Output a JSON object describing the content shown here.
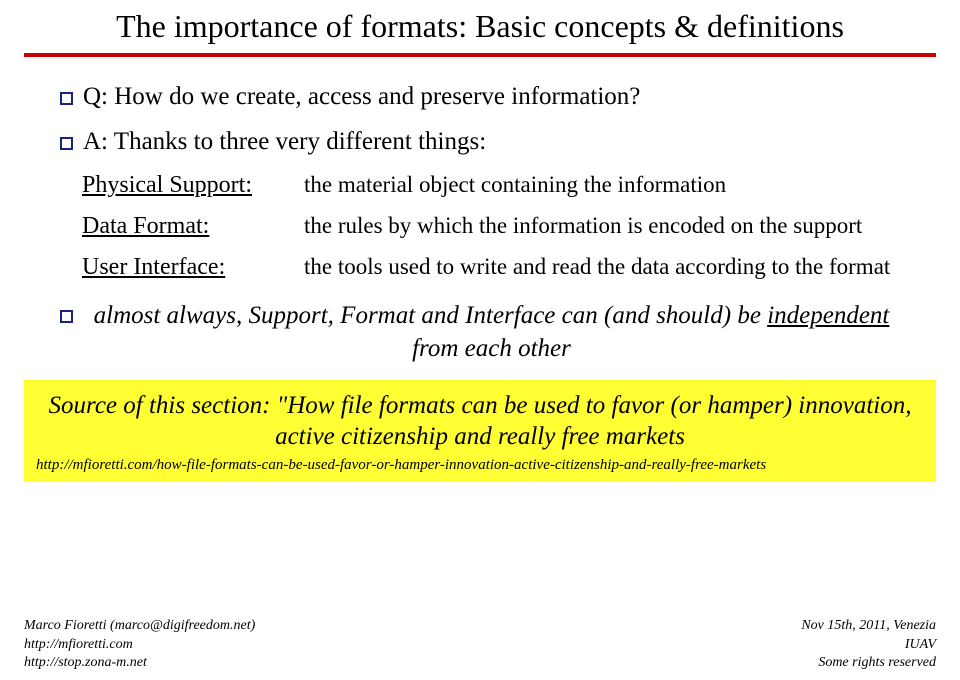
{
  "title": "The importance of formats: Basic concepts & definitions",
  "bullets": {
    "q": "Q: How do we create, access and preserve information?",
    "a": "A: Thanks to three very different things:"
  },
  "defs": [
    {
      "term": "Physical Support:",
      "desc": "the material object containing the information"
    },
    {
      "term": "Data Format:",
      "desc": "the rules by which the information is encoded on the support"
    },
    {
      "term": "User Interface:",
      "desc": "the tools used to write and read the data according to the format"
    }
  ],
  "emphasis": {
    "pre": "almost always, Support, Format and Interface can (and should) be ",
    "u": "independent",
    "post": " from each other"
  },
  "source": {
    "line1": "Source of this section: \"How file formats can be used to favor (or hamper) innovation, active citizenship and really free markets",
    "line2": "http://mfioretti.com/how-file-formats-can-be-used-favor-or-hamper-innovation-active-citizenship-and-really-free-markets"
  },
  "footer": {
    "left1": "Marco Fioretti (marco@digifreedom.net)",
    "left2": "http://mfioretti.com",
    "left3": "http://stop.zona-m.net",
    "right1": "Nov 15th, 2011, Venezia",
    "right2": "IUAV",
    "right3": "Some rights reserved"
  }
}
